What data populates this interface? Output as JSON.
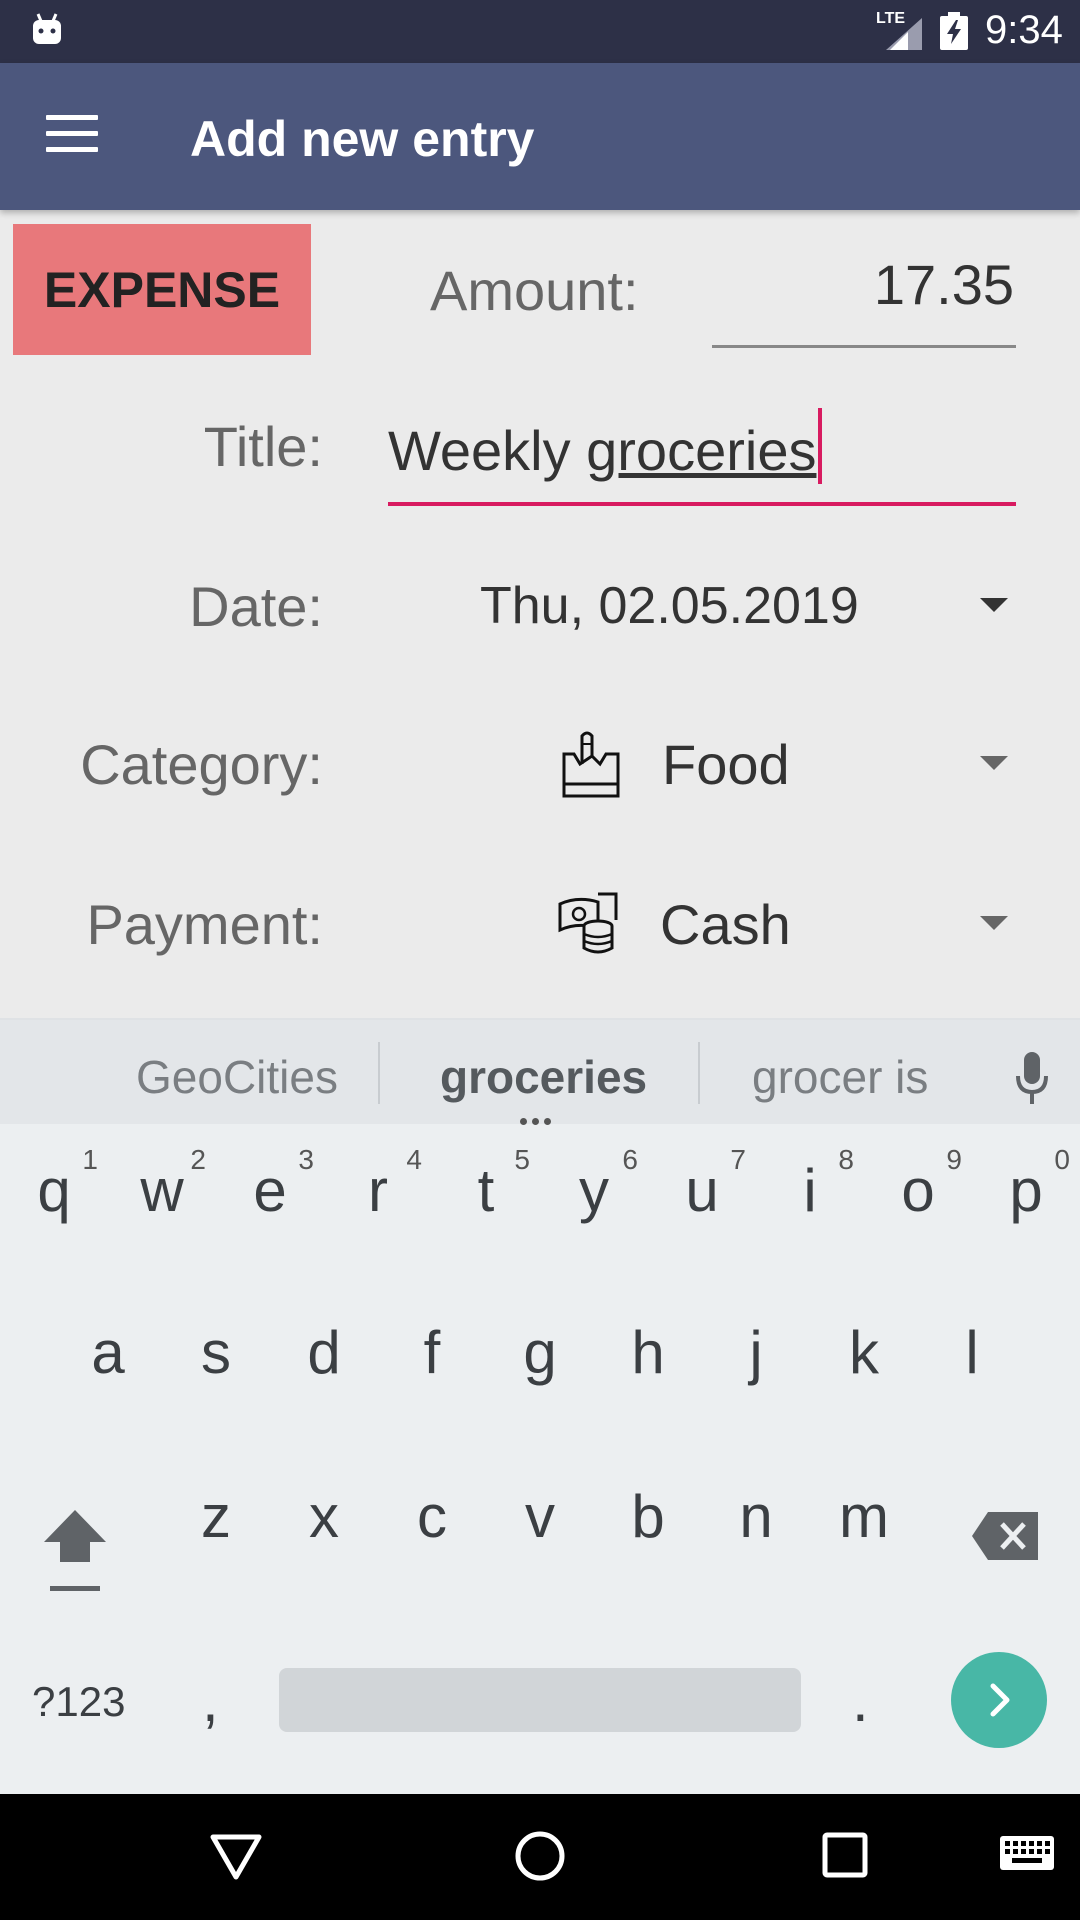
{
  "status_bar": {
    "network": "LTE",
    "time": "9:34"
  },
  "app_bar": {
    "title": "Add new entry"
  },
  "form": {
    "type_toggle": "EXPENSE",
    "amount_label": "Amount:",
    "amount_value": "17.35",
    "title_label": "Title:",
    "title_prefix": "Weekly ",
    "title_composing": "groceries",
    "date_label": "Date:",
    "date_value": "Thu, 02.05.2019",
    "category_label": "Category:",
    "category_value": "Food",
    "category_icon": "grocery-bag-icon",
    "payment_label": "Payment:",
    "payment_value": "Cash",
    "payment_icon": "cash-coins-icon"
  },
  "keyboard": {
    "suggestions": [
      "GeoCities",
      "groceries",
      "grocer is"
    ],
    "row1": [
      "q",
      "w",
      "e",
      "r",
      "t",
      "y",
      "u",
      "i",
      "o",
      "p"
    ],
    "row1_hints": [
      "1",
      "2",
      "3",
      "4",
      "5",
      "6",
      "7",
      "8",
      "9",
      "0"
    ],
    "row2": [
      "a",
      "s",
      "d",
      "f",
      "g",
      "h",
      "j",
      "k",
      "l"
    ],
    "row3": [
      "z",
      "x",
      "c",
      "v",
      "b",
      "n",
      "m"
    ],
    "symbols_key": "?123",
    "comma": ",",
    "period": "."
  },
  "colors": {
    "accent": "#d81b60",
    "expense": "#e8787b",
    "app_bar": "#4c577d",
    "status_bar": "#2d3047",
    "go_key": "#48b7a6"
  }
}
